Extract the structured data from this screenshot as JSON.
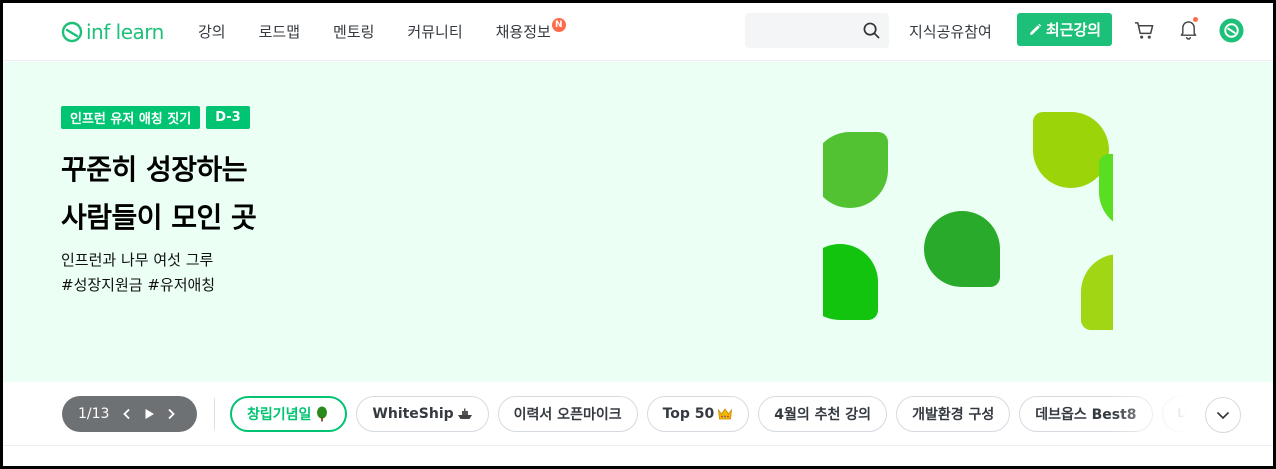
{
  "header": {
    "logo_text": "inf learn",
    "nav": [
      {
        "label": "강의",
        "badge": ""
      },
      {
        "label": "로드맵",
        "badge": ""
      },
      {
        "label": "멘토링",
        "badge": ""
      },
      {
        "label": "커뮤니티",
        "badge": ""
      },
      {
        "label": "채용정보",
        "badge": "N"
      }
    ],
    "search_placeholder": "",
    "share_label": "지식공유참여",
    "recent_button": "최근강의"
  },
  "hero": {
    "tags": [
      "인프런 유저 애칭 짓기",
      "D-3"
    ],
    "title_line1": "꾸준히 성장하는",
    "title_line2": "사람들이 모인 곳",
    "sub_line1": "인프런과 나무 여섯 그루",
    "sub_line2": "#성장지원금 #유저애칭"
  },
  "carousel": {
    "count": "1/13",
    "chips": [
      {
        "label": "창립기념일",
        "icon": "tree-icon",
        "active": true
      },
      {
        "label": "WhiteShip",
        "icon": "ship-icon",
        "active": false
      },
      {
        "label": "이력서 오픈마이크",
        "icon": "",
        "active": false
      },
      {
        "label": "Top 50",
        "icon": "crown-icon",
        "active": false
      },
      {
        "label": "4월의 추천 강의",
        "icon": "",
        "active": false
      },
      {
        "label": "개발환경 구성",
        "icon": "",
        "active": false
      },
      {
        "label": "데브옵스 Best8",
        "icon": "",
        "active": false
      },
      {
        "label": "나에게 맞",
        "icon": "",
        "active": false
      }
    ]
  },
  "colors": {
    "brand": "#1dc078",
    "tag_green": "#00c471",
    "hero_bg": "#ebfff4",
    "pager_bg": "#6e7173"
  }
}
